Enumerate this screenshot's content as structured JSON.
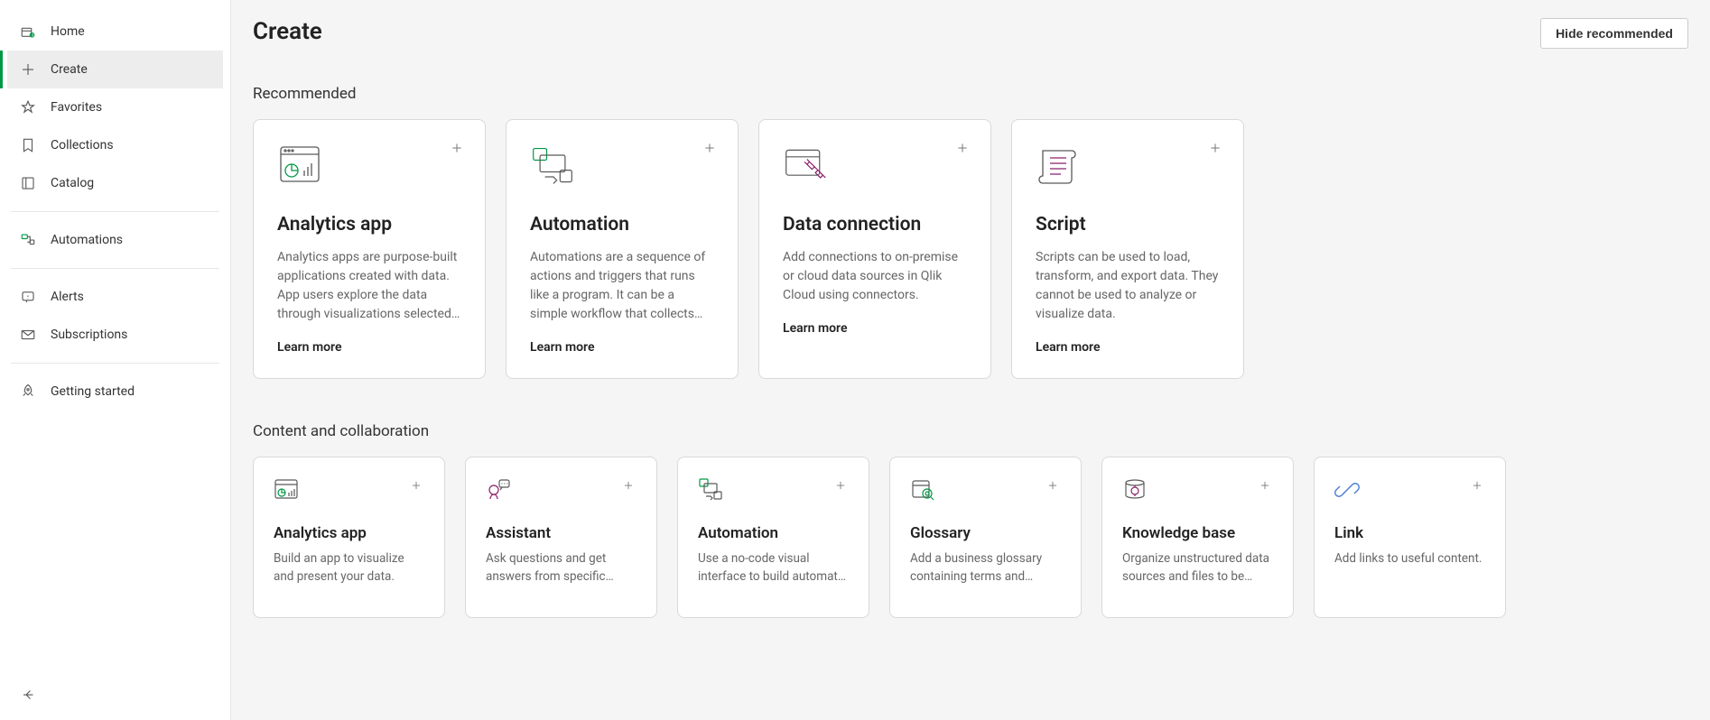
{
  "sidebar": {
    "items": [
      {
        "label": "Home"
      },
      {
        "label": "Create"
      },
      {
        "label": "Favorites"
      },
      {
        "label": "Collections"
      },
      {
        "label": "Catalog"
      },
      {
        "label": "Automations"
      },
      {
        "label": "Alerts"
      },
      {
        "label": "Subscriptions"
      },
      {
        "label": "Getting started"
      }
    ]
  },
  "header": {
    "title": "Create",
    "hide_button": "Hide recommended"
  },
  "sections": {
    "recommended": {
      "title": "Recommended",
      "cards": [
        {
          "title": "Analytics app",
          "desc": "Analytics apps are purpose-built applications created with data. App users explore the data through visualizations selected and…",
          "learn": "Learn more"
        },
        {
          "title": "Automation",
          "desc": "Automations are a sequence of actions and triggers that runs like a program. It can be a simple workflow that collects information from one…",
          "learn": "Learn more"
        },
        {
          "title": "Data connection",
          "desc": "Add connections to on-premise or cloud data sources in Qlik Cloud using connectors.",
          "learn": "Learn more"
        },
        {
          "title": "Script",
          "desc": "Scripts can be used to load, transform, and export data. They cannot be used to analyze or visualize data.",
          "learn": "Learn more"
        }
      ]
    },
    "content": {
      "title": "Content and collaboration",
      "cards": [
        {
          "title": "Analytics app",
          "desc": "Build an app to visualize and present your data."
        },
        {
          "title": "Assistant",
          "desc": "Ask questions and get answers from specific…"
        },
        {
          "title": "Automation",
          "desc": "Use a no-code visual interface to build automat…"
        },
        {
          "title": "Glossary",
          "desc": "Add a business glossary containing terms and…"
        },
        {
          "title": "Knowledge base",
          "desc": "Organize unstructured data sources and files to be use…"
        },
        {
          "title": "Link",
          "desc": "Add links to useful content."
        }
      ]
    }
  }
}
